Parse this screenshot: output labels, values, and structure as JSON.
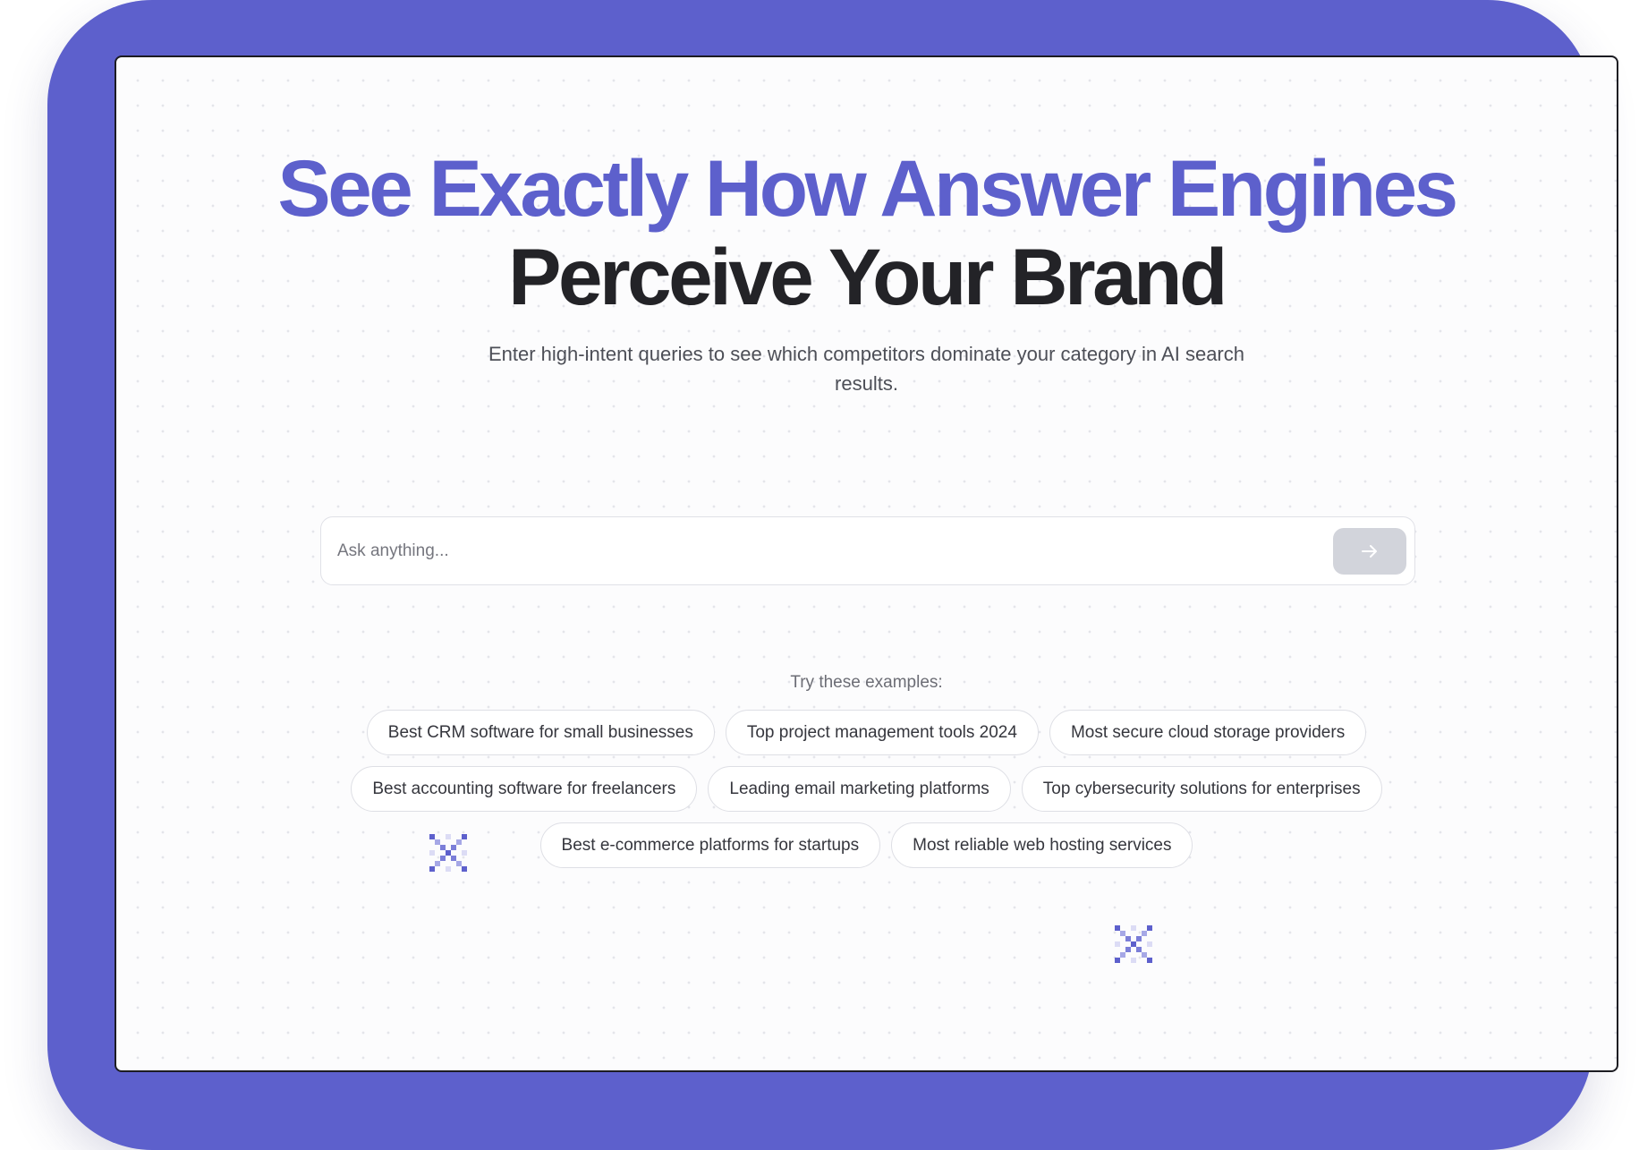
{
  "hero": {
    "headline_line1": "See Exactly How Answer Engines",
    "headline_line2": "Perceive Your Brand",
    "subtitle": "Enter high-intent queries to see which competitors dominate your category in AI search results."
  },
  "search": {
    "placeholder": "Ask anything...",
    "value": ""
  },
  "examples": {
    "label": "Try these examples:",
    "rows": [
      [
        "Best CRM software for small businesses",
        "Top project management tools 2024",
        "Most secure cloud storage providers"
      ],
      [
        "Best accounting software for freelancers",
        "Leading email marketing platforms",
        "Top cybersecurity solutions for enterprises"
      ],
      [
        "Best e-commerce platforms for startups",
        "Most reliable web hosting services"
      ]
    ]
  },
  "icons": {
    "submit": "arrow-right-icon",
    "decor": "pixel-sparkle-icon"
  },
  "colors": {
    "accent": "#5d60cc",
    "heading_dark": "#232327",
    "submit_disabled": "#d2d4db"
  }
}
